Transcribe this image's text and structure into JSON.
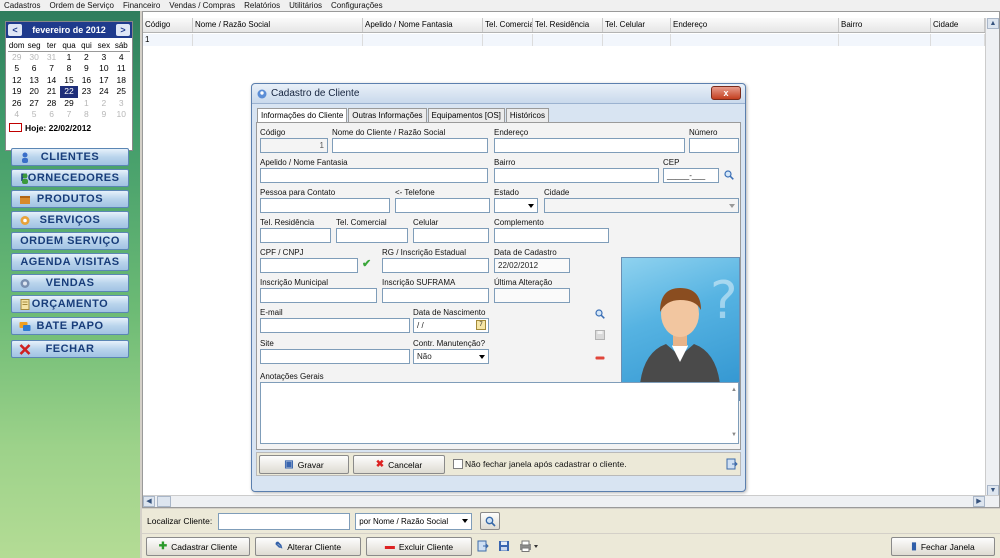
{
  "menu": [
    "Cadastros",
    "Ordem de Serviço",
    "Financeiro",
    "Vendas / Compras",
    "Relatórios",
    "Utilitários",
    "Configurações"
  ],
  "calendar": {
    "prev": "<",
    "next": ">",
    "title": "fevereiro de 2012",
    "weekdays": [
      "dom",
      "seg",
      "ter",
      "qua",
      "qui",
      "sex",
      "sáb"
    ],
    "weeks": [
      [
        [
          "29",
          "o"
        ],
        [
          "30",
          "o"
        ],
        [
          "31",
          "o"
        ],
        [
          "1",
          ""
        ],
        [
          "2",
          ""
        ],
        [
          "3",
          ""
        ],
        [
          "4",
          ""
        ]
      ],
      [
        [
          "5",
          ""
        ],
        [
          "6",
          ""
        ],
        [
          "7",
          ""
        ],
        [
          "8",
          ""
        ],
        [
          "9",
          ""
        ],
        [
          "10",
          ""
        ],
        [
          "11",
          ""
        ]
      ],
      [
        [
          "12",
          ""
        ],
        [
          "13",
          ""
        ],
        [
          "14",
          ""
        ],
        [
          "15",
          ""
        ],
        [
          "16",
          ""
        ],
        [
          "17",
          ""
        ],
        [
          "18",
          ""
        ]
      ],
      [
        [
          "19",
          ""
        ],
        [
          "20",
          ""
        ],
        [
          "21",
          ""
        ],
        [
          "22",
          "t"
        ],
        [
          "23",
          ""
        ],
        [
          "24",
          ""
        ],
        [
          "25",
          ""
        ]
      ],
      [
        [
          "26",
          ""
        ],
        [
          "27",
          ""
        ],
        [
          "28",
          ""
        ],
        [
          "29",
          ""
        ],
        [
          "1",
          "o"
        ],
        [
          "2",
          "o"
        ],
        [
          "3",
          "o"
        ]
      ],
      [
        [
          "4",
          "o"
        ],
        [
          "5",
          "o"
        ],
        [
          "6",
          "o"
        ],
        [
          "7",
          "o"
        ],
        [
          "8",
          "o"
        ],
        [
          "9",
          "o"
        ],
        [
          "10",
          "o"
        ]
      ]
    ],
    "today_label": "Hoje: 22/02/2012"
  },
  "nav": {
    "clientes": "CLIENTES",
    "fornecedores": "FORNECEDORES",
    "produtos": "PRODUTOS",
    "servicos": "SERVIÇOS",
    "ordem_servico": "ORDEM SERVIÇO",
    "agenda_visitas": "AGENDA VISITAS",
    "vendas": "VENDAS",
    "orcamento": "ORÇAMENTO",
    "bate_papo": "BATE PAPO",
    "fechar": "FECHAR"
  },
  "grid": {
    "columns": [
      "Código",
      "Nome / Razão Social",
      "Apelido / Nome Fantasia",
      "Tel. Comercial",
      "Tel. Residência",
      "Tel. Celular",
      "Endereço",
      "Bairro",
      "Cidade"
    ],
    "rows": [
      [
        "1",
        "",
        "",
        "",
        "",
        "",
        "",
        "",
        ""
      ]
    ]
  },
  "search": {
    "label": "Localizar Cliente:",
    "value": "",
    "by_value": "por Nome / Razão Social"
  },
  "actions": {
    "cadastrar": "Cadastrar Cliente",
    "alterar": "Alterar Cliente",
    "excluir": "Excluir Cliente",
    "fechar_janela": "Fechar Janela"
  },
  "dialog": {
    "title": "Cadastro de Cliente",
    "close": "x",
    "tabs": [
      "Informações do Cliente",
      "Outras Informações",
      "Equipamentos [OS]",
      "Históricos"
    ],
    "labels": {
      "codigo": "Código",
      "nome": "Nome do Cliente / Razão Social",
      "endereco": "Endereço",
      "numero": "Número",
      "apelido": "Apelido / Nome Fantasia",
      "bairro": "Bairro",
      "cep": "CEP",
      "pessoa_contato": "Pessoa para Contato",
      "telefone": "<- Telefone",
      "estado": "Estado",
      "cidade": "Cidade",
      "tel_residencia": "Tel. Residência",
      "tel_comercial": "Tel. Comercial",
      "celular": "Celular",
      "complemento": "Complemento",
      "cpf_cnpj": "CPF / CNPJ",
      "rg": "RG / Inscrição Estadual",
      "data_cadastro": "Data de Cadastro",
      "insc_municipal": "Inscrição Municipal",
      "insc_suframa": "Inscrição SUFRAMA",
      "ultima_alteracao": "Última Alteração",
      "email": "E-mail",
      "data_nascimento": "Data de Nascimento",
      "site": "Site",
      "contr_manutencao": "Contr. Manutenção?",
      "anotacoes": "Anotações Gerais"
    },
    "values": {
      "codigo": "1",
      "cep": "_____-___",
      "data_cadastro": "22/02/2012",
      "data_nascimento": " /  /",
      "contr_manutencao": "Não"
    },
    "gravar": "Gravar",
    "cancelar": "Cancelar",
    "nao_fechar": "Não fechar janela após cadastrar o cliente."
  }
}
